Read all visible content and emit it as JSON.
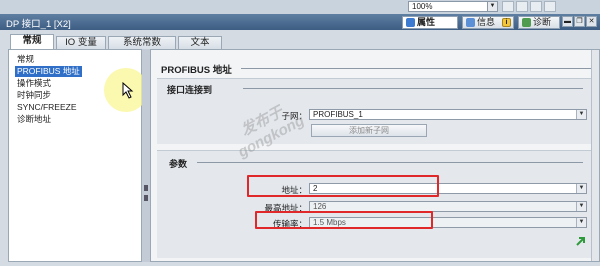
{
  "toolbar": {
    "zoom_value": "100%"
  },
  "window": {
    "title": "DP 接口_1 [X2]"
  },
  "inspector_tabs": [
    {
      "label": "属性",
      "icon": "properties-icon",
      "active": true
    },
    {
      "label": "信息",
      "icon": "info-icon",
      "badge": "i"
    },
    {
      "label": "诊断",
      "icon": "diagnostics-icon"
    }
  ],
  "tabs": [
    {
      "label": "常规",
      "active": true
    },
    {
      "label": "IO 变量"
    },
    {
      "label": "系统常数"
    },
    {
      "label": "文本"
    }
  ],
  "nav": {
    "items": [
      {
        "label": "常规"
      },
      {
        "label": "PROFIBUS 地址",
        "selected": true
      },
      {
        "label": "操作模式"
      },
      {
        "label": "时钟同步"
      },
      {
        "label": "SYNC/FREEZE"
      },
      {
        "label": "诊断地址"
      }
    ]
  },
  "content": {
    "section_title": "PROFIBUS 地址",
    "interface_group": {
      "title": "接口连接到",
      "subnet_label": "子网：",
      "subnet_value": "PROFIBUS_1",
      "add_subnet_button": "添加新子网"
    },
    "params_group": {
      "title": "参数",
      "address_label": "地址：",
      "address_value": "2",
      "max_address_label": "最高地址：",
      "max_address_value": "126",
      "baud_label": "传输率：",
      "baud_value": "1.5 Mbps"
    }
  },
  "watermark": {
    "line1": "发布于",
    "line2": "gongkong"
  },
  "colors": {
    "highlight_box": "#e0282b",
    "selection": "#2f6fc8",
    "title_bar": "#4a6a90"
  }
}
